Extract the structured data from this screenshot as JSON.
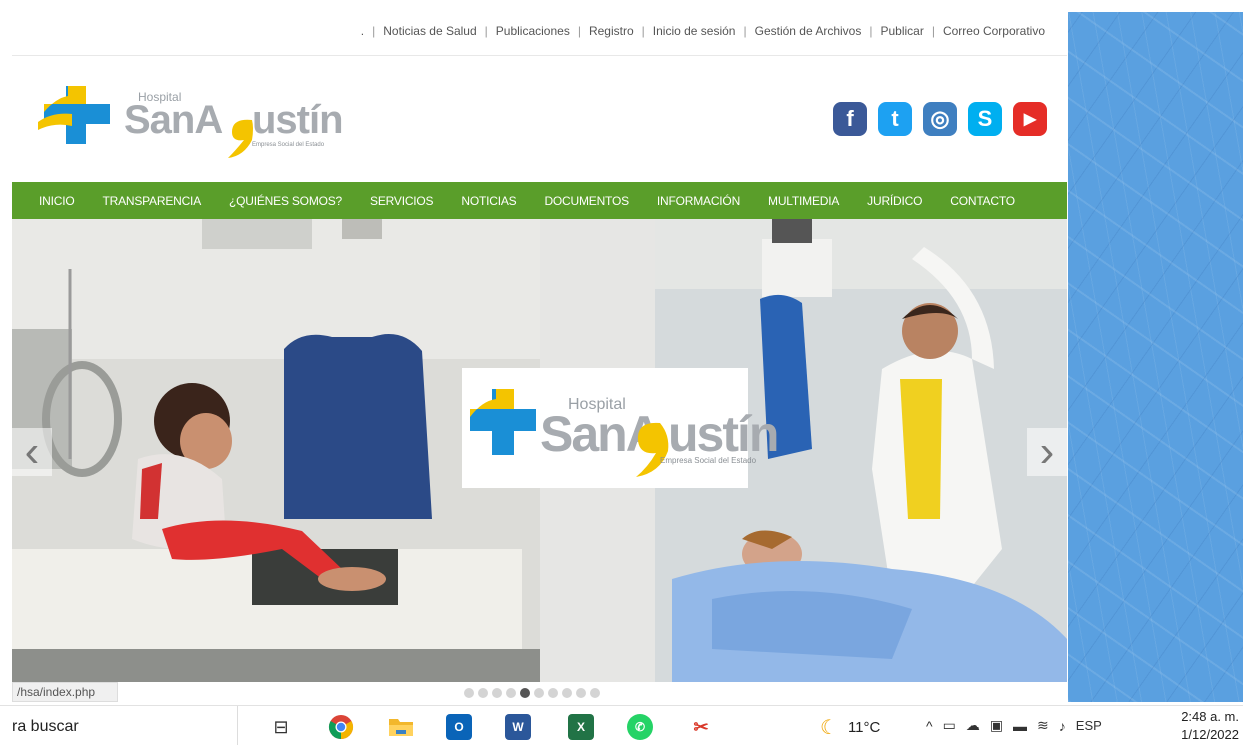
{
  "top_links": {
    "dot": ".",
    "items": [
      "Noticias de Salud",
      "Publicaciones",
      "Registro",
      "Inicio de sesión",
      "Gestión de Archivos",
      "Publicar",
      "Correo Corporativo"
    ]
  },
  "logo": {
    "hospital": "Hospital",
    "name_part1": "SanA",
    "name_part2": "ustín",
    "tagline": "Empresa Social del Estado"
  },
  "social": [
    {
      "name": "facebook-icon",
      "glyph": "f",
      "color": "#3b5998"
    },
    {
      "name": "twitter-icon",
      "glyph": "t",
      "color": "#1da1f2"
    },
    {
      "name": "instagram-icon",
      "glyph": "◎",
      "color": "#3f7fc0"
    },
    {
      "name": "skype-icon",
      "glyph": "S",
      "color": "#00aff0"
    },
    {
      "name": "youtube-icon",
      "glyph": "▶",
      "color": "#e52d27"
    }
  ],
  "nav": [
    "INICIO",
    "TRANSPARENCIA",
    "¿QUIÉNES SOMOS?",
    "SERVICIOS",
    "NOTICIAS",
    "DOCUMENTOS",
    "INFORMACIÓN",
    "MULTIMEDIA",
    "JURÍDICO",
    "CONTACTO"
  ],
  "slider": {
    "prev_glyph": "‹",
    "next_glyph": "›",
    "dot_count": 10,
    "active_dot": 4
  },
  "status_url": "/hsa/index.php",
  "taskbar": {
    "search_text": "ra buscar",
    "temperature": "11°C",
    "language": "ESP",
    "time": "2:48 a. m.",
    "date": "1/12/2022"
  },
  "colors": {
    "nav_green": "#5a9e2a",
    "logo_yellow": "#f4c400",
    "logo_blue": "#1a8fd6",
    "desktop_blue": "#5aa0e0"
  }
}
